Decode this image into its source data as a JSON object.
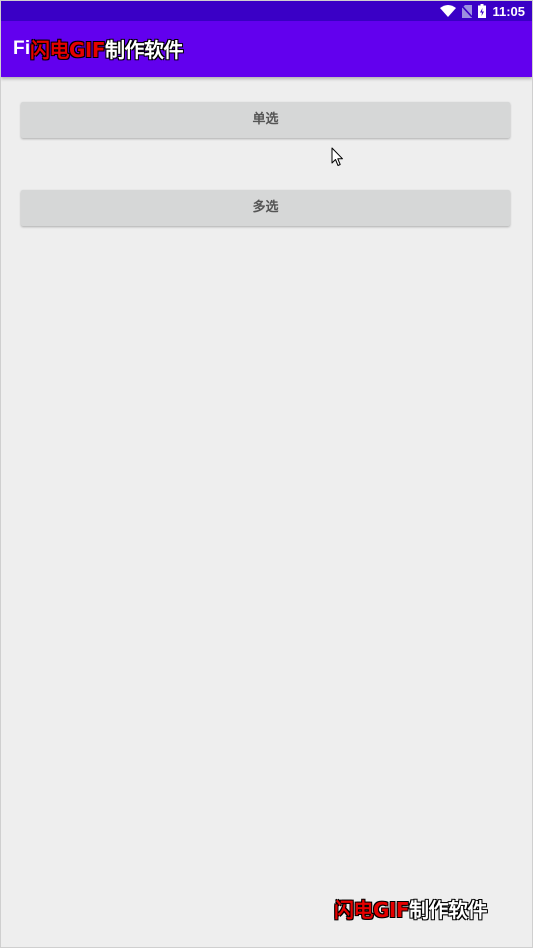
{
  "status_bar": {
    "time": "11:05",
    "icons": [
      "wifi-icon",
      "no-sim-icon",
      "battery-charging-icon"
    ]
  },
  "app_bar": {
    "title": "Fi"
  },
  "buttons": {
    "single_select": "单选",
    "multi_select": "多选"
  },
  "watermark": {
    "red_text": "闪电GIF",
    "white_text": "制作软件"
  },
  "colors": {
    "status_bar": "#3a00c6",
    "app_bar": "#6200ee",
    "background": "#eeeeee",
    "button": "#d6d7d7",
    "button_text": "#555555"
  }
}
